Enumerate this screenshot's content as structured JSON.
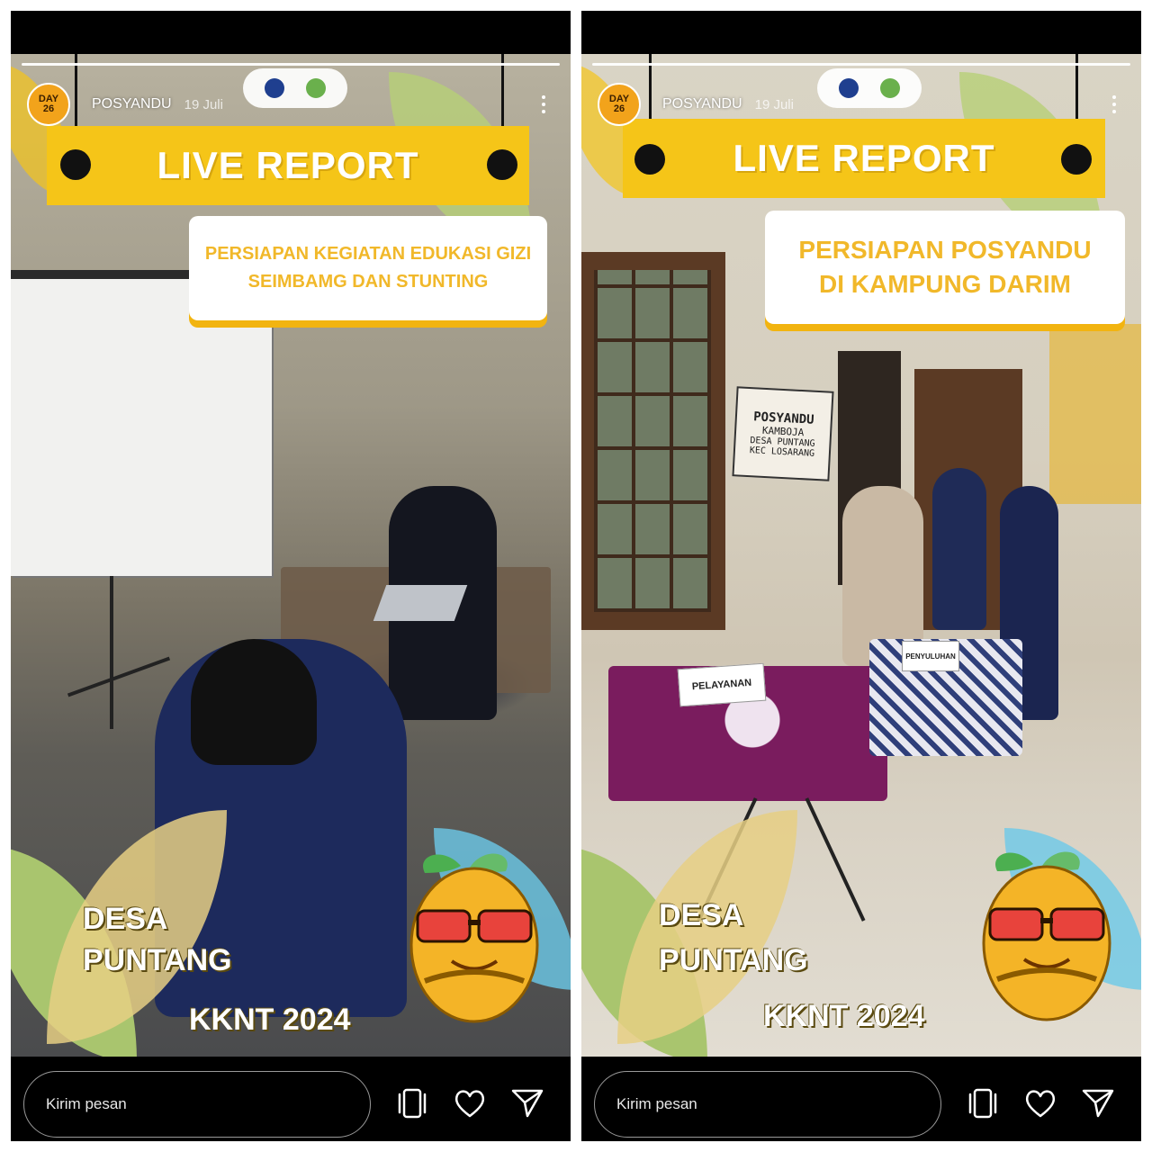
{
  "stories": [
    {
      "avatar": {
        "line1": "DAY",
        "line2": "26"
      },
      "username": "POSYANDU",
      "date": "19 Juli",
      "banner_title": "LIVE REPORT",
      "subtitle": {
        "line1": "PERSIAPAN KEGIATAN EDUKASI GIZI",
        "line2": "SEIMBAMG DAN STUNTING"
      },
      "desa": {
        "line1": "DESA",
        "line2": "PUNTANG"
      },
      "kknt": "KKNT 2024",
      "message_placeholder": "Kirim pesan"
    },
    {
      "avatar": {
        "line1": "DAY",
        "line2": "26"
      },
      "username": "POSYANDU",
      "date": "19 Juli",
      "banner_title": "LIVE REPORT",
      "subtitle": {
        "line1": "PERSIAPAN POSYANDU",
        "line2": "DI KAMPUNG DARIM"
      },
      "sign": {
        "line1": "POSYANDU",
        "line2": "KAMBOJA",
        "line3": "DESA PUNTANG",
        "line4": "KEC LOSARANG"
      },
      "table_labels": {
        "left": "PELAYANAN",
        "right": "PENYULUHAN"
      },
      "desa": {
        "line1": "DESA",
        "line2": "PUNTANG"
      },
      "kknt": "KKNT 2024",
      "message_placeholder": "Kirim pesan"
    }
  ],
  "colors": {
    "banner_yellow": "#f5c518",
    "subtitle_text": "#f1b82a",
    "avatar": "#f2a31b"
  },
  "icons": [
    "more-options-icon",
    "repost-icon",
    "heart-icon",
    "send-icon"
  ]
}
